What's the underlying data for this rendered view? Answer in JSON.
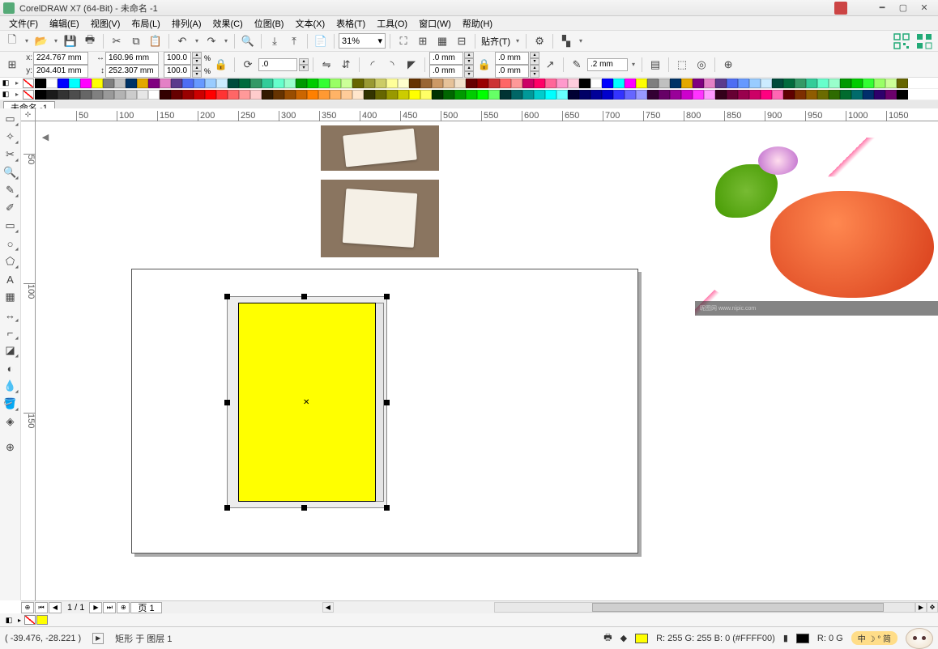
{
  "title": "CorelDRAW X7 (64-Bit) - 未命名 -1",
  "menus": [
    "文件(F)",
    "编辑(E)",
    "视图(V)",
    "布局(L)",
    "排列(A)",
    "效果(C)",
    "位图(B)",
    "文本(X)",
    "表格(T)",
    "工具(O)",
    "窗口(W)",
    "帮助(H)"
  ],
  "toolbar1": {
    "zoom": "31%",
    "snap_label": "贴齐(T)"
  },
  "propbar": {
    "x_label": "x:",
    "y_label": "y:",
    "x": "224.767 mm",
    "y": "204.401 mm",
    "w": "160.96 mm",
    "h": "252.307 mm",
    "sx": "100.0",
    "sy": "100.0",
    "rot": ".0",
    "corner_all": ".0 mm",
    "outline": ".2 mm",
    "pct": "%"
  },
  "doctab": "未命名 -1",
  "page_nav": {
    "pages": "1 / 1",
    "tab": "页 1"
  },
  "status": {
    "cursor": "( -39.476, -28.221 )",
    "object": "矩形 于 图层 1",
    "fill": "R: 255 G: 255 B: 0 (#FFFF00)",
    "outline": "R: 0 G",
    "ime": "中 ☽ ° 简"
  },
  "colors_top": [
    "#000000",
    "#ffffff",
    "#0000ff",
    "#00ffff",
    "#ff00ff",
    "#ffff00",
    "#7f7f7f",
    "#c0c0c0",
    "#003366",
    "#e3a800",
    "#800080",
    "#e481c6",
    "#5b3b8c",
    "#4d6df3",
    "#6699ff",
    "#99ccff",
    "#ccecff",
    "#004b3b",
    "#006b3c",
    "#339966",
    "#33cc99",
    "#66ffcc",
    "#99ffcc",
    "#009900",
    "#00cc00",
    "#33ff33",
    "#99ff66",
    "#ccff99",
    "#666600",
    "#999933",
    "#cccc66",
    "#ffff99",
    "#ffffcc",
    "#663300",
    "#996633",
    "#cc9966",
    "#e6c299",
    "#f2e2cc",
    "#660000",
    "#990000",
    "#cc3333",
    "#ff6666",
    "#ff9999",
    "#cc0066",
    "#ff0066",
    "#ff6699",
    "#ff99cc",
    "#ffccdd"
  ],
  "colors_bot": [
    "#000000",
    "#1a1a1a",
    "#333333",
    "#4d4d4d",
    "#666666",
    "#808080",
    "#999999",
    "#b3b3b3",
    "#cccccc",
    "#e6e6e6",
    "#ffffff",
    "#330000",
    "#660000",
    "#990000",
    "#cc0000",
    "#ff0000",
    "#ff3333",
    "#ff6666",
    "#ff9999",
    "#ffcccc",
    "#331a00",
    "#663300",
    "#994d00",
    "#cc6600",
    "#ff8000",
    "#ff9933",
    "#ffb366",
    "#ffcc99",
    "#ffe6cc",
    "#333300",
    "#666600",
    "#999900",
    "#cccc00",
    "#ffff00",
    "#ffff66",
    "#003300",
    "#006600",
    "#009900",
    "#00cc00",
    "#00ff00",
    "#66ff66",
    "#003333",
    "#006666",
    "#009999",
    "#00cccc",
    "#00ffff",
    "#66ffff",
    "#000033",
    "#000066",
    "#000099",
    "#0000cc",
    "#3333ff",
    "#6666ff",
    "#9999ff",
    "#330033",
    "#660066",
    "#990099",
    "#cc00cc",
    "#ff33ff",
    "#ff99ff",
    "#33001a",
    "#660033",
    "#99004d",
    "#cc0066",
    "#ff0080",
    "#ff66b3",
    "#5f0000",
    "#7d2e00",
    "#8f5c00",
    "#6b6b00",
    "#2e6b00",
    "#006b2e",
    "#006b6b",
    "#002e6b",
    "#2e006b",
    "#6b006b"
  ],
  "ruler_h_ticks": [
    50,
    100,
    150,
    200,
    250,
    300,
    350,
    400,
    450,
    500,
    550,
    600,
    650,
    700,
    750,
    800,
    850,
    900,
    950,
    1000,
    1050
  ],
  "ruler_v_ticks": [
    50,
    100,
    150
  ]
}
